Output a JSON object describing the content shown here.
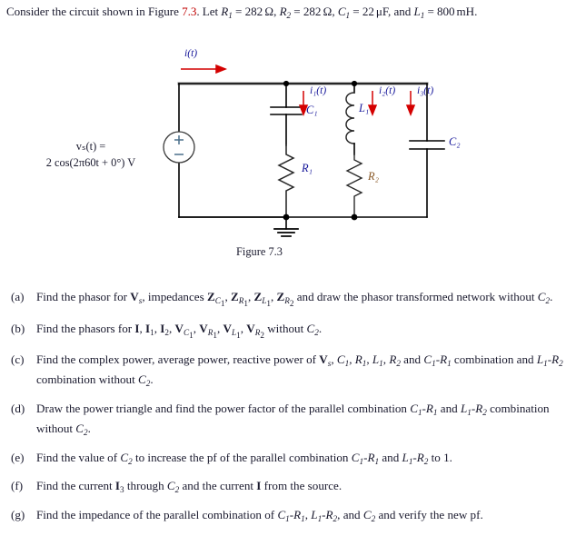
{
  "statement": {
    "prefix": "Consider the circuit shown in Figure",
    "figure_ref": "7.3",
    "after_ref": ". Let",
    "givens": [
      {
        "symbol": "R",
        "sub": "1",
        "value": "282",
        "unit": "Ω"
      },
      {
        "symbol": "R",
        "sub": "2",
        "value": "282",
        "unit": "Ω"
      },
      {
        "symbol": "C",
        "sub": "1",
        "value": "22",
        "unit": "μF"
      },
      {
        "symbol": "L",
        "sub": "1",
        "value": "800",
        "unit": "mH"
      }
    ],
    "conjunction": "and",
    "terminator": "."
  },
  "circuit": {
    "figure_caption": "Figure 7.3",
    "source": {
      "label_line1": "vₛ(t) =",
      "label_line2": "2 cos(2π60t + 0°) V",
      "plus": "+",
      "minus": "−"
    },
    "currents": [
      {
        "name": "i-total",
        "label": "i(t)"
      },
      {
        "name": "i1",
        "label": "i₁(t)"
      },
      {
        "name": "i2",
        "label": "i₂(t)"
      },
      {
        "name": "i3",
        "label": "i₃(t)"
      }
    ],
    "components": [
      {
        "name": "capacitor-c1",
        "label": "C₁"
      },
      {
        "name": "inductor-l1",
        "label": "L₁"
      },
      {
        "name": "capacitor-c2",
        "label": "C₂"
      },
      {
        "name": "resistor-r1",
        "label": "R₁"
      },
      {
        "name": "resistor-r2",
        "label": "R₂"
      }
    ],
    "colors": {
      "wire": "#000000",
      "wire_highlight": "#9a9a9a",
      "current_arrow": "#d40000",
      "label_blue": "#16179a",
      "label_brown": "#8a5a28"
    }
  },
  "questions": [
    {
      "marker": "(a)",
      "text": "Find the phasor for Vₛ, impedances Z_C₁, Z_R₁, Z_L₁, Z_R₂ and draw the phasor transformed network without C₂."
    },
    {
      "marker": "(b)",
      "text": "Find the phasors for I, I₁, I₂, V_C₁, V_R₁, V_L₁, V_R₂ without C₂."
    },
    {
      "marker": "(c)",
      "text": "Find the complex power, average power, reactive power of Vₛ, C₁, R₁, L₁, R₂ and C₁-R₁ combination and L₁-R₂ combination without C₂."
    },
    {
      "marker": "(d)",
      "text": "Draw the power triangle and find the power factor of the parallel combination C₁-R₁ and L₁-R₂ combination without C₂."
    },
    {
      "marker": "(e)",
      "text": "Find the value of C₂ to increase the pf of the parallel combination C₁-R₁ and L₁-R₂ to 1."
    },
    {
      "marker": "(f)",
      "text": "Find the current I₃ through C₂ and the current I from the source."
    },
    {
      "marker": "(g)",
      "text": "Find the impedance of the parallel combination of C₁-R₁, L₁-R₂, and C₂ and verify the new pf."
    }
  ]
}
